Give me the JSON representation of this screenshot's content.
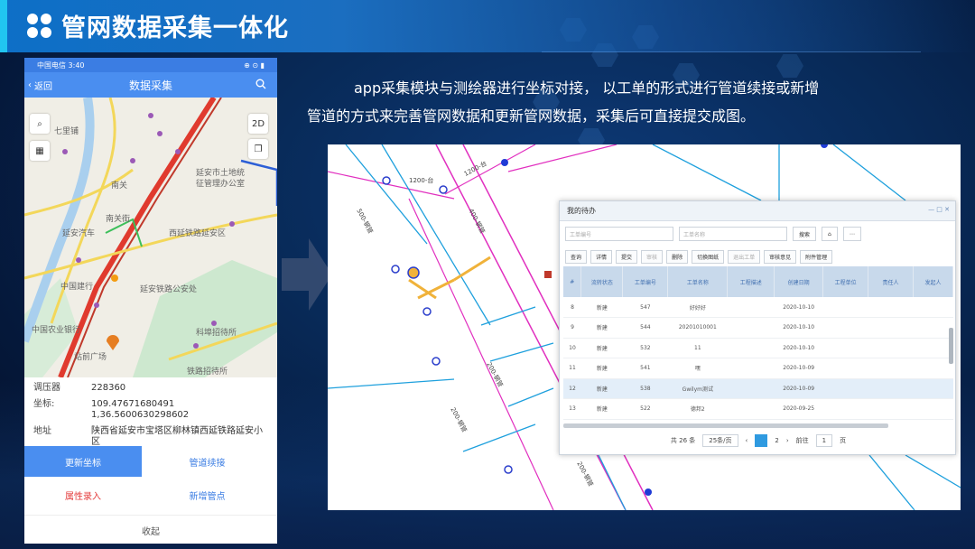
{
  "slide": {
    "title": "管网数据采集一体化",
    "description_line1": "app采集模块与测绘器进行坐标对接， 以工单的形式进行管道续接或新增",
    "description_line2": "管道的方式来完善管网数据和更新管网数据，采集后可直接提交成图。",
    "colors": {
      "accent": "#21c5f0",
      "title_bar": "#0d6fc7",
      "background": "#071d3c"
    }
  },
  "phone": {
    "status_carrier_time": "中国电信 3:40",
    "status_icons": "⊕ ⊙ ▮",
    "back_label": "返回",
    "title": "数据采集",
    "map_labels": {
      "qili": "七里铺",
      "nanyuan": "南关",
      "yanan_land": "延安市土地统",
      "yanan_land2": "征管理办公室",
      "xiyan_road": "西延铁路延安区",
      "yanan_auto": "延安汽车",
      "nanguan": "南关街",
      "yanan_railway": "延安铁路公安处",
      "zhongguo_bank": "中国建行",
      "zhongguo_nong": "中国农业银行",
      "kelong": "科埠招待所",
      "square": "站前广场",
      "railway_hotel": "铁路招待所"
    },
    "info": [
      {
        "key": "调压器",
        "value": "228360"
      },
      {
        "key": "坐标:",
        "value": "109.47671680491 1,36.5600630298602"
      },
      {
        "key": "地址",
        "value": "陕西省延安市宝塔区柳林镇西延铁路延安小区"
      }
    ],
    "buttons": {
      "update_coords": "更新坐标",
      "pipe_continue": "管道续接",
      "attr_entry": "属性录入",
      "add_node": "新增管点",
      "collapse": "收起"
    },
    "colors": {
      "primary": "#4a8ef0",
      "danger": "#e43c3c"
    }
  },
  "work_panel": {
    "title": "我的待办",
    "search_placeholder_1": "工单编号",
    "search_placeholder_2": "工单名称",
    "search_button": "搜索",
    "toolbar": [
      "查询",
      "详情",
      "提交",
      "审核",
      "删除",
      "切换图纸",
      "退出工单",
      "审核意见",
      "附件管理"
    ],
    "columns": [
      "#",
      "流转状态",
      "工单编号",
      "工单名称",
      "工程描述",
      "创建日期",
      "工程单位",
      "责任人",
      "发起人"
    ],
    "rows": [
      {
        "n": "8",
        "status": "新建",
        "no": "547",
        "name": "好好好",
        "date": "2020-10-10"
      },
      {
        "n": "9",
        "status": "新建",
        "no": "544",
        "name": "20201010001",
        "date": "2020-10-10"
      },
      {
        "n": "10",
        "status": "新建",
        "no": "532",
        "name": "11",
        "date": "2020-10-10"
      },
      {
        "n": "11",
        "status": "新建",
        "no": "541",
        "name": "嘿",
        "date": "2020-10-09"
      },
      {
        "n": "12",
        "status": "新建",
        "no": "538",
        "name": "Gwilym测试",
        "date": "2020-10-09"
      },
      {
        "n": "13",
        "status": "新建",
        "no": "522",
        "name": "德邦2",
        "date": "2020-09-25"
      }
    ],
    "pager": {
      "total": "共 26 条",
      "page_size": "25条/页",
      "prev": "‹",
      "page2": "2",
      "next": "›",
      "goto": "前往",
      "page_input": "1",
      "page_unit": "页"
    }
  },
  "map_shot": {
    "labels": [
      "1200-台",
      "1200-台",
      "500-钢管",
      "400-钢管",
      "200-钢管",
      "200-钢管",
      "200-钢管"
    ]
  }
}
